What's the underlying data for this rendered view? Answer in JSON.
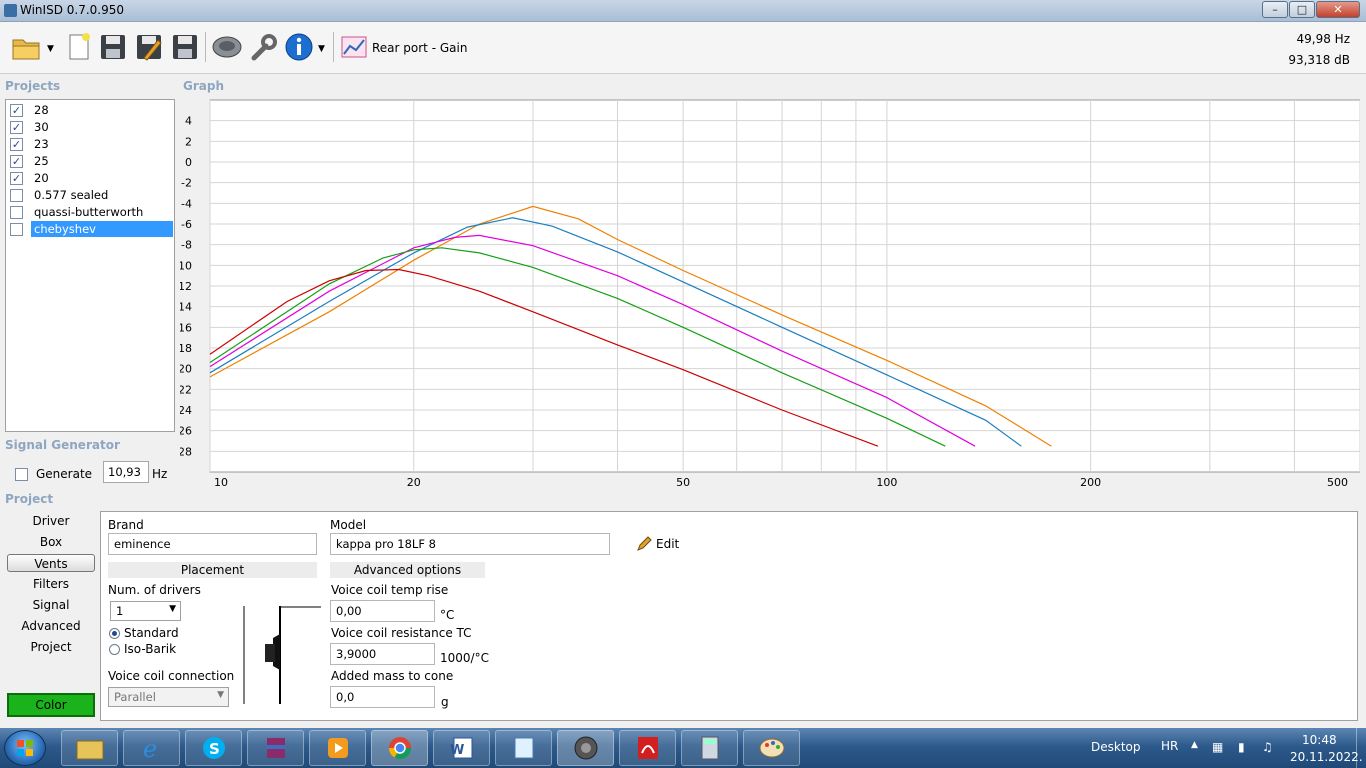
{
  "window": {
    "title": "WinISD 0.7.0.950"
  },
  "toolbar": {
    "graph_label": "Rear port - Gain",
    "readout_hz": "49,98 Hz",
    "readout_db": "93,318 dB"
  },
  "projects": {
    "label": "Projects",
    "items": [
      {
        "label": "28",
        "checked": true,
        "color": "#f08000"
      },
      {
        "label": "30",
        "checked": true,
        "color": "#1a7fc0"
      },
      {
        "label": "23",
        "checked": true,
        "color": "#e000e0"
      },
      {
        "label": "25",
        "checked": true,
        "color": "#16a016"
      },
      {
        "label": "20",
        "checked": true,
        "color": "#cc0000"
      },
      {
        "label": "0.577 sealed",
        "checked": false
      },
      {
        "label": "quassi-butterworth",
        "checked": false
      },
      {
        "label": "chebyshev",
        "checked": false,
        "selected": true
      }
    ]
  },
  "graph": {
    "label": "Graph"
  },
  "chart_data": {
    "type": "line",
    "xscale": "log",
    "xlim": [
      10,
      500
    ],
    "ylim": [
      -30,
      6
    ],
    "xticks": [
      "10",
      "20",
      "50",
      "100",
      "200",
      "500"
    ],
    "yticks": [
      "4",
      "2",
      "0",
      "-2",
      "-4",
      "-6",
      "-8",
      "-10",
      "-12",
      "-14",
      "-16",
      "-18",
      "-20",
      "-22",
      "-24",
      "-26",
      "-28"
    ],
    "grid": true,
    "series": [
      {
        "color": "#f08000",
        "points": [
          [
            10,
            -20.8
          ],
          [
            15,
            -14.5
          ],
          [
            20,
            -9.5
          ],
          [
            25,
            -6.0
          ],
          [
            30,
            -4.3
          ],
          [
            35,
            -5.5
          ],
          [
            40,
            -7.5
          ],
          [
            50,
            -10.5
          ],
          [
            70,
            -14.8
          ],
          [
            100,
            -19.2
          ],
          [
            140,
            -23.6
          ],
          [
            175,
            -27.5
          ]
        ]
      },
      {
        "color": "#1a7fc0",
        "points": [
          [
            10,
            -20.4
          ],
          [
            15,
            -13.5
          ],
          [
            20,
            -8.8
          ],
          [
            24,
            -6.3
          ],
          [
            28,
            -5.4
          ],
          [
            32,
            -6.2
          ],
          [
            40,
            -8.7
          ],
          [
            50,
            -11.6
          ],
          [
            70,
            -16.0
          ],
          [
            100,
            -20.6
          ],
          [
            140,
            -25.0
          ],
          [
            158,
            -27.5
          ]
        ]
      },
      {
        "color": "#e000e0",
        "points": [
          [
            10,
            -19.8
          ],
          [
            15,
            -12.5
          ],
          [
            20,
            -8.3
          ],
          [
            23,
            -7.3
          ],
          [
            25,
            -7.1
          ],
          [
            30,
            -8.1
          ],
          [
            40,
            -11.0
          ],
          [
            50,
            -13.8
          ],
          [
            70,
            -18.3
          ],
          [
            100,
            -22.8
          ],
          [
            135,
            -27.5
          ]
        ]
      },
      {
        "color": "#16a016",
        "points": [
          [
            10,
            -19.4
          ],
          [
            15,
            -11.8
          ],
          [
            18,
            -9.3
          ],
          [
            20,
            -8.5
          ],
          [
            22,
            -8.3
          ],
          [
            25,
            -8.8
          ],
          [
            30,
            -10.2
          ],
          [
            40,
            -13.2
          ],
          [
            50,
            -16.0
          ],
          [
            70,
            -20.4
          ],
          [
            100,
            -24.8
          ],
          [
            122,
            -27.5
          ]
        ]
      },
      {
        "color": "#cc0000",
        "points": [
          [
            10,
            -18.6
          ],
          [
            13,
            -13.5
          ],
          [
            15,
            -11.5
          ],
          [
            17,
            -10.5
          ],
          [
            19,
            -10.4
          ],
          [
            21,
            -11.0
          ],
          [
            25,
            -12.5
          ],
          [
            30,
            -14.5
          ],
          [
            40,
            -17.7
          ],
          [
            50,
            -20.1
          ],
          [
            70,
            -24.0
          ],
          [
            97,
            -27.5
          ]
        ]
      }
    ]
  },
  "signal_generator": {
    "label": "Signal Generator",
    "generate_label": "Generate",
    "value": "10,93",
    "unit": "Hz"
  },
  "project": {
    "label": "Project",
    "nav": [
      "Driver",
      "Box",
      "Vents",
      "Filters",
      "Signal",
      "Advanced",
      "Project"
    ],
    "active_nav": "Vents",
    "color_label": "Color",
    "color": "#1bb31b"
  },
  "driver": {
    "brand_label": "Brand",
    "brand_value": "eminence",
    "model_label": "Model",
    "model_value": "kappa pro 18LF 8",
    "edit_label": "Edit",
    "placement_header": "Placement",
    "advanced_header": "Advanced options",
    "num_drivers_label": "Num. of drivers",
    "num_drivers_value": "1",
    "standard_label": "Standard",
    "isobarik_label": "Iso-Barik",
    "vc_connection_label": "Voice coil connection",
    "vc_connection_value": "Parallel",
    "vc_temp_label": "Voice coil temp rise",
    "vc_temp_value": "0,00",
    "vc_temp_unit": "°C",
    "vc_res_label": "Voice coil resistance TC",
    "vc_res_value": "3,9000",
    "vc_res_unit": "1000/°C",
    "mass_label": "Added mass to cone",
    "mass_value": "0,0",
    "mass_unit": "g"
  },
  "taskbar": {
    "desktop_label": "Desktop",
    "lang": "HR",
    "time": "10:48",
    "date": "20.11.2022."
  }
}
